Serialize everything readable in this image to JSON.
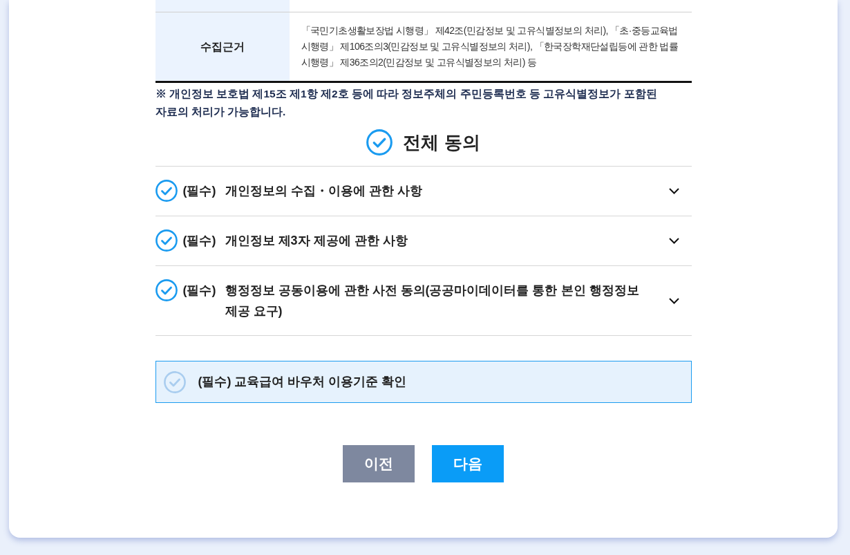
{
  "basis_table": {
    "rows": [
      {
        "header": "수집근거",
        "content": "「국민기초생활보장법 시행령」 제42조(민감정보 및 고유식별정보의 처리), 「초·중등교육법 시행령」 제106조의3(민감정보 및 고유식별정보의 처리), 「한국장학재단설립등에 관한 법률 시행령」 제36조의2(민감정보 및 고유식별정보의 처리) 등"
      }
    ]
  },
  "notice": "※ 개인정보 보호법 제15조 제1항 제2호 등에 따라 정보주체의 주민등록번호 등 고유식별정보가 포함된 자료의 처리가 가능합니다.",
  "agree_all": {
    "label": "전체 동의",
    "checked": true
  },
  "agreements": [
    {
      "tag": "(필수)",
      "label": "개인정보의 수집・이용에 관한 사항",
      "checked": true,
      "expanded": false
    },
    {
      "tag": "(필수)",
      "label": "개인정보 제3자 제공에 관한 사항",
      "checked": true,
      "expanded": false
    },
    {
      "tag": "(필수)",
      "label": "행정정보 공동이용에 관한 사전 동의(공공마이데이터를 통한 본인 행정정보 제공 요구)",
      "checked": true,
      "expanded": false
    }
  ],
  "confirmation": {
    "label": "(필수) 교육급여 바우처 이용기준 확인",
    "checked": false
  },
  "buttons": [
    {
      "label": "이전",
      "kind": "secondary"
    },
    {
      "label": "다음",
      "kind": "primary"
    }
  ]
}
